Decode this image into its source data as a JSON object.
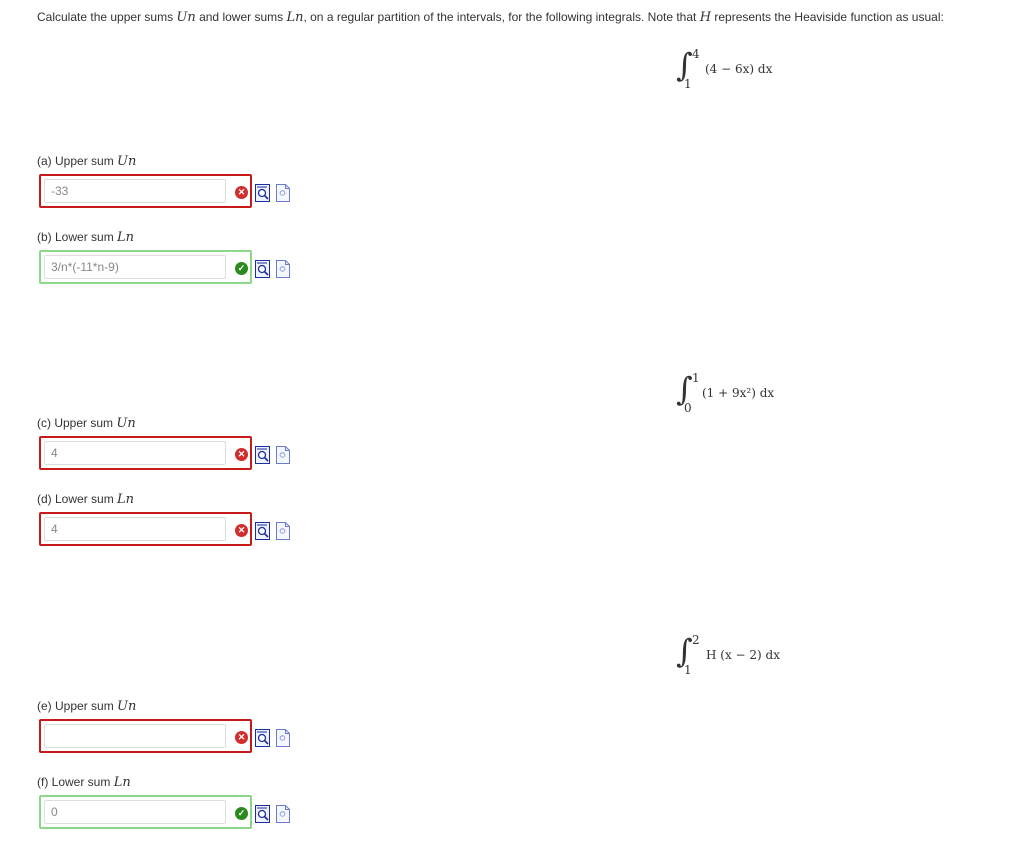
{
  "instructions": {
    "text_before_u": "Calculate the upper sums ",
    "u_symbol": "Un",
    "text_between": " and lower sums ",
    "l_symbol": "Ln",
    "text_before_h": ", on a regular partition of the intervals, for the following integrals. Note that ",
    "h_symbol": "H",
    "text_after_h": " represents the Heaviside function as usual:"
  },
  "integrals": [
    {
      "upper": "4",
      "lower": "1",
      "integrand": "(4 − 6x) dx"
    },
    {
      "upper": "1",
      "lower": "0",
      "integrand": "(1 + 9x²) dx"
    },
    {
      "upper": "2",
      "lower": "1",
      "integrand": "H (x − 2) dx"
    }
  ],
  "questions": [
    {
      "label": "(a) Upper sum ",
      "symbol": "Un",
      "value": "-33",
      "status": "incorrect"
    },
    {
      "label": "(b) Lower sum ",
      "symbol": "Ln",
      "value": "3/n*(-11*n-9)",
      "status": "correct"
    },
    {
      "label": "(c) Upper sum ",
      "symbol": "Un",
      "value": "4",
      "status": "incorrect"
    },
    {
      "label": "(d) Lower sum ",
      "symbol": "Ln",
      "value": "4",
      "status": "incorrect"
    },
    {
      "label": "(e) Upper sum ",
      "symbol": "Un",
      "value": "",
      "status": "incorrect"
    },
    {
      "label": "(f) Lower sum ",
      "symbol": "Ln",
      "value": "0",
      "status": "correct"
    }
  ],
  "icons": {
    "incorrect": "error-x-icon",
    "correct": "checkmark-icon",
    "preview": "preview-magnifier-icon",
    "document": "document-icon"
  },
  "colors": {
    "incorrect_border": "#c91a1a",
    "correct_border": "#8bd88b",
    "incorrect_icon": "#d22d2d",
    "correct_icon": "#2b8a1e"
  }
}
